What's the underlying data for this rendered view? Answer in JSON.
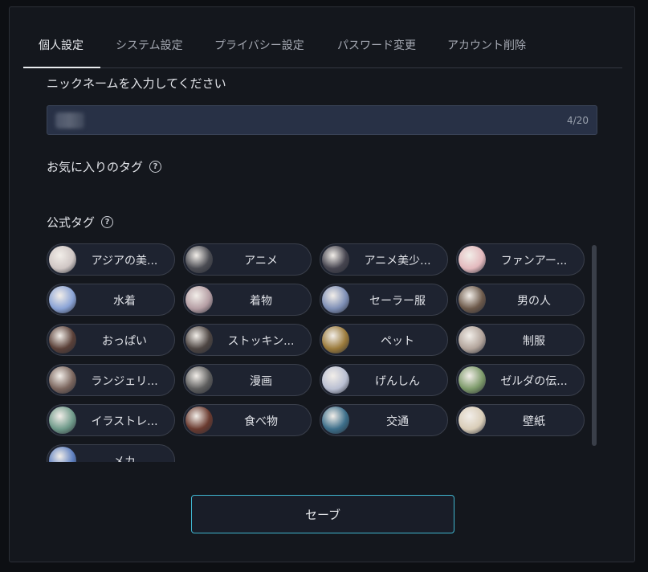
{
  "tabs": [
    {
      "label": "個人設定",
      "active": true
    },
    {
      "label": "システム設定",
      "active": false
    },
    {
      "label": "プライバシー設定",
      "active": false
    },
    {
      "label": "パスワード変更",
      "active": false
    },
    {
      "label": "アカウント削除",
      "active": false
    }
  ],
  "nickname": {
    "label": "ニックネームを入力してください",
    "count": "4/20"
  },
  "favorite_tags": {
    "label": "お気に入りのタグ",
    "help_icon": "?"
  },
  "official_tags": {
    "label": "公式タグ",
    "help_icon": "?",
    "items": [
      {
        "name": "アジアの美...",
        "color": "#cfc6c4"
      },
      {
        "name": "アニメ",
        "color": "#4a4b52"
      },
      {
        "name": "アニメ美少...",
        "color": "#45444f"
      },
      {
        "name": "ファンアー...",
        "color": "#e3b9bd"
      },
      {
        "name": "水着",
        "color": "#8aa3d6"
      },
      {
        "name": "着物",
        "color": "#b59ea4"
      },
      {
        "name": "セーラー服",
        "color": "#7e8fb6"
      },
      {
        "name": "男の人",
        "color": "#6d5a4b"
      },
      {
        "name": "おっぱい",
        "color": "#5a4038"
      },
      {
        "name": "ストッキン...",
        "color": "#4d4542"
      },
      {
        "name": "ペット",
        "color": "#9a7a3b"
      },
      {
        "name": "制服",
        "color": "#b2a49b"
      },
      {
        "name": "ランジェリ...",
        "color": "#7a655d"
      },
      {
        "name": "漫画",
        "color": "#5d5d5d"
      },
      {
        "name": "げんしん",
        "color": "#b9bfd2"
      },
      {
        "name": "ゼルダの伝...",
        "color": "#7d9a6a"
      },
      {
        "name": "イラストレ...",
        "color": "#6f9a8a"
      },
      {
        "name": "食べ物",
        "color": "#6a3a2f"
      },
      {
        "name": "交通",
        "color": "#3c6e8a"
      },
      {
        "name": "壁紙",
        "color": "#d9cdb8"
      },
      {
        "name": "メカ",
        "color": "#5d7fc0"
      }
    ]
  },
  "save_label": "セーブ",
  "colors": {
    "accent": "#3fb5cf",
    "panel": "#14171d",
    "input": "#283146"
  }
}
